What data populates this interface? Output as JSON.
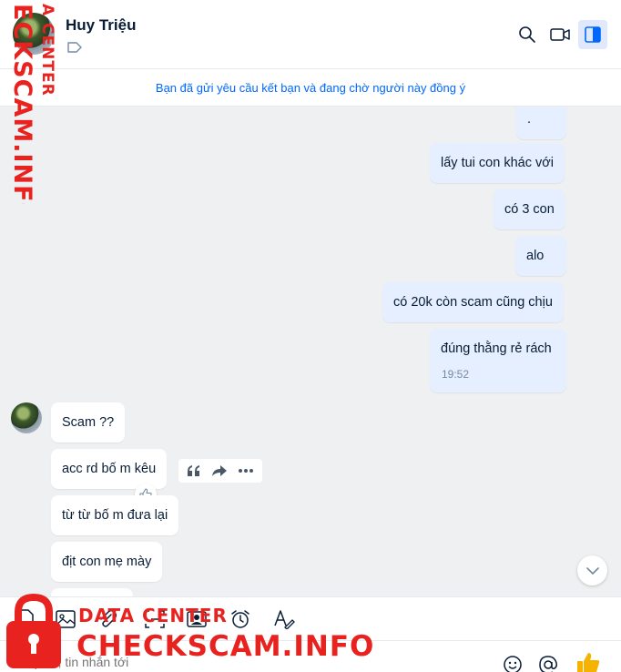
{
  "header": {
    "contact_name": "Huy Triệu",
    "icons": [
      "tag-icon",
      "search-icon",
      "video-call-icon",
      "sidebar-toggle-icon"
    ]
  },
  "notice": {
    "text": "Bạn đã gửi yêu cầu kết bạn và đang chờ người này đồng ý"
  },
  "messages": {
    "outgoing": [
      {
        "text": "."
      },
      {
        "text": "lấy tui con khác với"
      },
      {
        "text": "có 3 con"
      },
      {
        "text": "alo"
      },
      {
        "text": "có 20k còn scam cũng chịu"
      },
      {
        "text": "đúng thằng rẻ rách",
        "time": "19:52"
      }
    ],
    "incoming": [
      {
        "text": "Scam ??"
      },
      {
        "text": "acc rd bố m kêu"
      },
      {
        "text": "từ từ bố m đưa lại"
      },
      {
        "text": "địt con mẹ mày"
      }
    ]
  },
  "message_actions": [
    "quote-icon",
    "forward-icon",
    "more-icon"
  ],
  "toolbar": {
    "icons": [
      "sticker-icon",
      "image-icon",
      "attachment-icon",
      "screenshot-icon",
      "contact-card-icon",
      "reminder-icon",
      "format-text-icon"
    ]
  },
  "composer": {
    "placeholder": "Nhập @, tin nhắn tới"
  },
  "watermark": {
    "vertical_small": "A CENTER",
    "vertical_big": "ECKSCAM.INFO",
    "small": "DATA CENTER",
    "big": "CHECKSCAM.INFO"
  },
  "colors": {
    "accent": "#0068ff",
    "outgoing_bubble": "#e5efff",
    "chat_background": "#eef0f1",
    "watermark": "#e8221f",
    "like": "#f5b300"
  }
}
